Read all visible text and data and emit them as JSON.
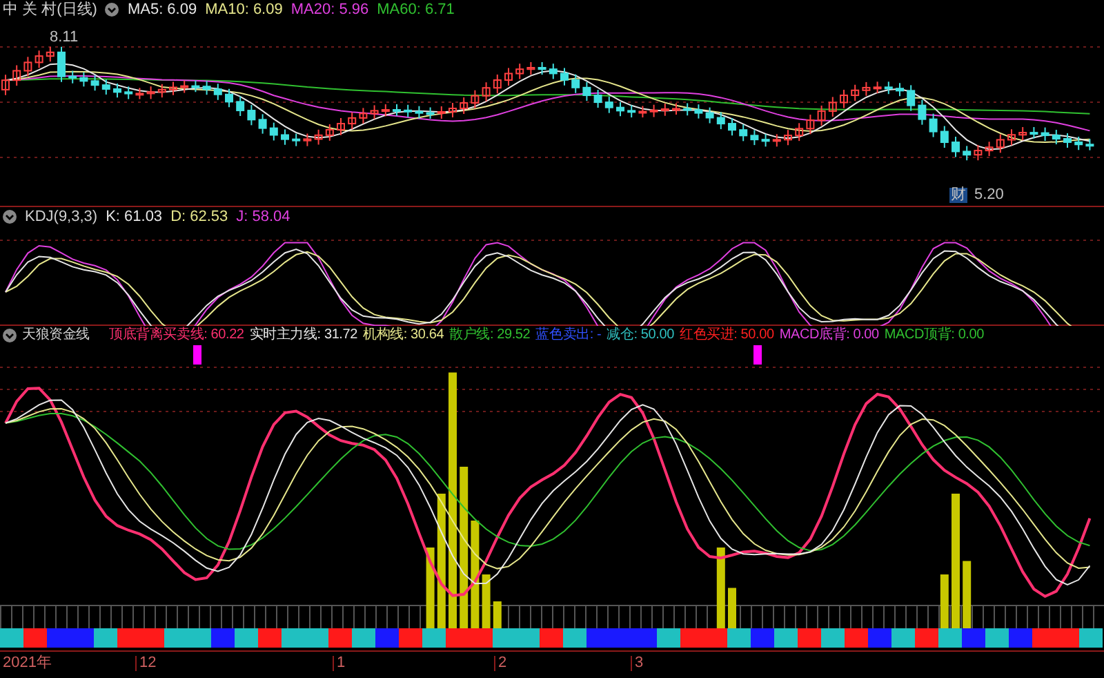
{
  "main_chart": {
    "title": "中 关 村(日线)",
    "indicators": [
      {
        "label": "MA5: 6.09",
        "color": "#e6e6e6"
      },
      {
        "label": "MA10: 6.09",
        "color": "#e6e68c"
      },
      {
        "label": "MA20: 5.96",
        "color": "#e040e0"
      },
      {
        "label": "MA60: 6.71",
        "color": "#30c030"
      }
    ],
    "high_label": "8.11",
    "low_label": "5.20",
    "event_badge": "财"
  },
  "kdj": {
    "title": "KDJ(9,3,3)",
    "values": [
      {
        "label": "K: 61.03",
        "color": "#e6e6e6"
      },
      {
        "label": "D: 62.53",
        "color": "#e6e68c"
      },
      {
        "label": "J: 58.04",
        "color": "#e040e0"
      }
    ]
  },
  "indicator": {
    "title": "天狼资金线",
    "values": [
      {
        "label": "顶底背离买卖线: 60.22",
        "color": "#ff3070"
      },
      {
        "label": "实时主力线: 31.72",
        "color": "#e6e6e6"
      },
      {
        "label": "机构线: 30.64",
        "color": "#e6e68c"
      },
      {
        "label": "散户线: 29.52",
        "color": "#30c030"
      },
      {
        "label": "蓝色卖出: -",
        "color": "#3050ff"
      },
      {
        "label": "减仓: 50.00",
        "color": "#30c0c0"
      },
      {
        "label": "红色买进: 50.00",
        "color": "#ff2020"
      },
      {
        "label": "MACD底背: 0.00",
        "color": "#e040e0"
      },
      {
        "label": "MACD顶背: 0.00",
        "color": "#30c030"
      }
    ]
  },
  "time_axis": [
    "2021年",
    "12",
    "1",
    "2",
    "3"
  ]
}
